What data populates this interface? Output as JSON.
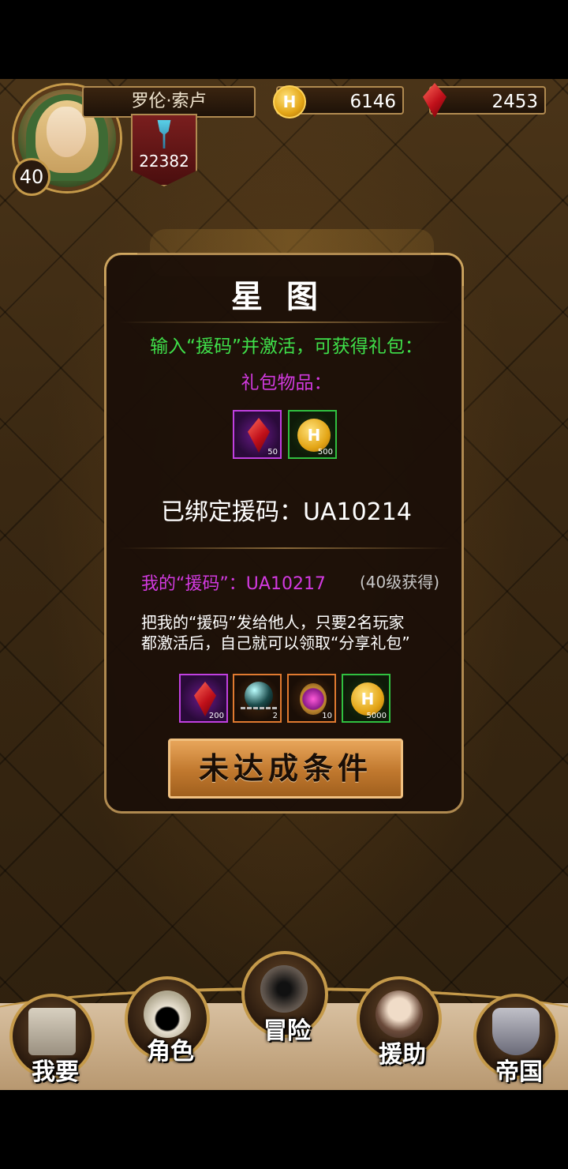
{
  "player": {
    "name": "罗伦·索卢",
    "level": "40",
    "power": "22382",
    "gold": "6146",
    "gems": "2453"
  },
  "panel": {
    "title": "星图",
    "activate_prompt": "输入“援码”并激活，可获得礼包：",
    "gift_items_label": "礼包物品：",
    "gift_items": [
      {
        "icon": "red-gem-icon",
        "count": "50"
      },
      {
        "icon": "gold-coin-icon",
        "count": "500"
      }
    ],
    "bound_code": "已绑定援码：UA10214",
    "my_code": "我的“援码”：UA10217",
    "my_code_note": "(40级获得)",
    "share_desc_line1": "把我的“援码”发给他人，只要2名玩家",
    "share_desc_line2": "都激活后，自己就可以领取“分享礼包”",
    "share_items": [
      {
        "icon": "red-gem-icon",
        "count": "200"
      },
      {
        "icon": "dark-orb-icon",
        "count": "2"
      },
      {
        "icon": "amulet-icon",
        "count": "10"
      },
      {
        "icon": "gold-coin-icon",
        "count": "5000"
      }
    ],
    "button_label": "未达成条件"
  },
  "nav": [
    {
      "id": "want",
      "label": "我要",
      "icon": "castle-icon"
    },
    {
      "id": "character",
      "label": "角色",
      "icon": "hooded-figure-icon"
    },
    {
      "id": "adventure",
      "label": "冒险",
      "icon": "swords-dungeon-icon"
    },
    {
      "id": "assist",
      "label": "援助",
      "icon": "girl-portrait-icon"
    },
    {
      "id": "empire",
      "label": "帝国",
      "icon": "crown-icon"
    }
  ],
  "colors": {
    "accent_green": "#3fe04a",
    "accent_purple": "#d23ae0",
    "gold_border": "#b08a50",
    "button_orange": "#c0782e"
  }
}
